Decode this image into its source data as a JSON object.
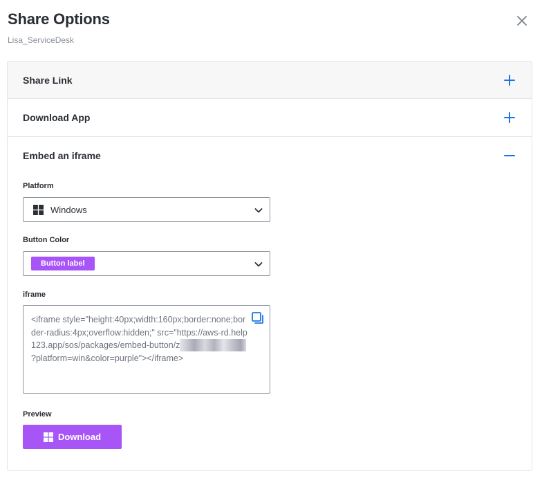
{
  "header": {
    "title": "Share Options",
    "subtitle": "Lisa_ServiceDesk",
    "close_icon": "close-icon"
  },
  "sections": [
    {
      "label": "Share Link",
      "expanded": false,
      "toggle_icon": "plus-icon"
    },
    {
      "label": "Download App",
      "expanded": false,
      "toggle_icon": "plus-icon"
    },
    {
      "label": "Embed an iframe",
      "expanded": true,
      "toggle_icon": "minus-icon"
    }
  ],
  "embed": {
    "platform": {
      "label": "Platform",
      "value": "Windows",
      "icon": "windows-icon"
    },
    "button_color": {
      "label": "Button Color",
      "value": "Button label",
      "color": "#a855f7"
    },
    "iframe": {
      "label": "iframe",
      "code_before": "<iframe style=\"height:40px;width:160px;border:none;border-radius:4px;overflow:hidden;\" src=\"https://aws-rd.help123.app/sos/packages/embed-button/z",
      "code_after": "?platform=win&color=purple\"></iframe>",
      "copy_icon": "copy-icon"
    },
    "preview": {
      "label": "Preview",
      "button_label": "Download",
      "icon": "windows-icon"
    }
  },
  "colors": {
    "accent": "#1a73e8",
    "purple": "#a855f7",
    "border": "#e2e4e8",
    "text": "#2a2e35"
  }
}
